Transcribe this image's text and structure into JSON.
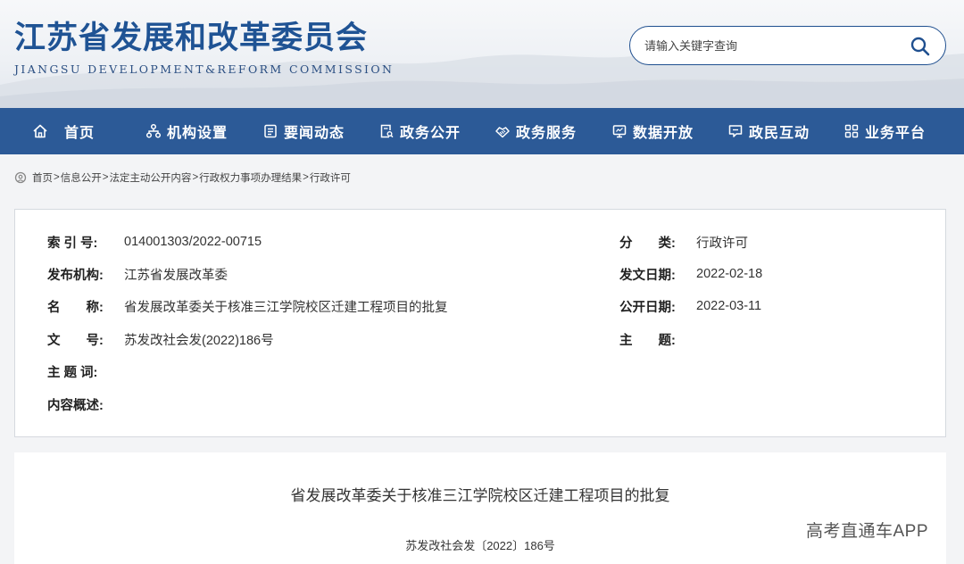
{
  "header": {
    "title": "江苏省发展和改革委员会",
    "subtitle": "JIANGSU DEVELOPMENT&REFORM COMMISSION",
    "search_placeholder": "请输入关键字查询"
  },
  "nav": {
    "items": [
      {
        "label": "首页",
        "icon": "home-icon"
      },
      {
        "label": "机构设置",
        "icon": "org-chart-icon"
      },
      {
        "label": "要闻动态",
        "icon": "news-icon"
      },
      {
        "label": "政务公开",
        "icon": "document-search-icon"
      },
      {
        "label": "政务服务",
        "icon": "service-icon"
      },
      {
        "label": "数据开放",
        "icon": "monitor-icon"
      },
      {
        "label": "政民互动",
        "icon": "chat-icon"
      },
      {
        "label": "业务平台",
        "icon": "grid-icon"
      }
    ]
  },
  "breadcrumb": {
    "items": [
      "首页",
      "信息公开",
      "法定主动公开内容",
      "行政权力事项办理结果",
      "行政许可"
    ],
    "separator": ">"
  },
  "info": {
    "index_label": "索 引 号:",
    "index_value": "014001303/2022-00715",
    "category_label": "分　　类:",
    "category_value": "行政许可",
    "publisher_label": "发布机构:",
    "publisher_value": "江苏省发展改革委",
    "issue_date_label": "发文日期:",
    "issue_date_value": "2022-02-18",
    "name_label": "名　　称:",
    "name_value": "省发展改革委关于核准三江学院校区迁建工程项目的批复",
    "public_date_label": "公开日期:",
    "public_date_value": "2022-03-11",
    "doc_no_label": "文　　号:",
    "doc_no_value": "苏发改社会发(2022)186号",
    "topic_label": "主　　题:",
    "topic_value": "",
    "keywords_label": "主 题 词:",
    "keywords_value": "",
    "summary_label": "内容概述:",
    "summary_value": ""
  },
  "document": {
    "title": "省发展改革委关于核准三江学院校区迁建工程项目的批复",
    "number": "苏发改社会发〔2022〕186号"
  },
  "watermark": "高考直通车APP",
  "colors": {
    "brand_blue": "#1f5394",
    "nav_blue": "#2c5a97"
  }
}
